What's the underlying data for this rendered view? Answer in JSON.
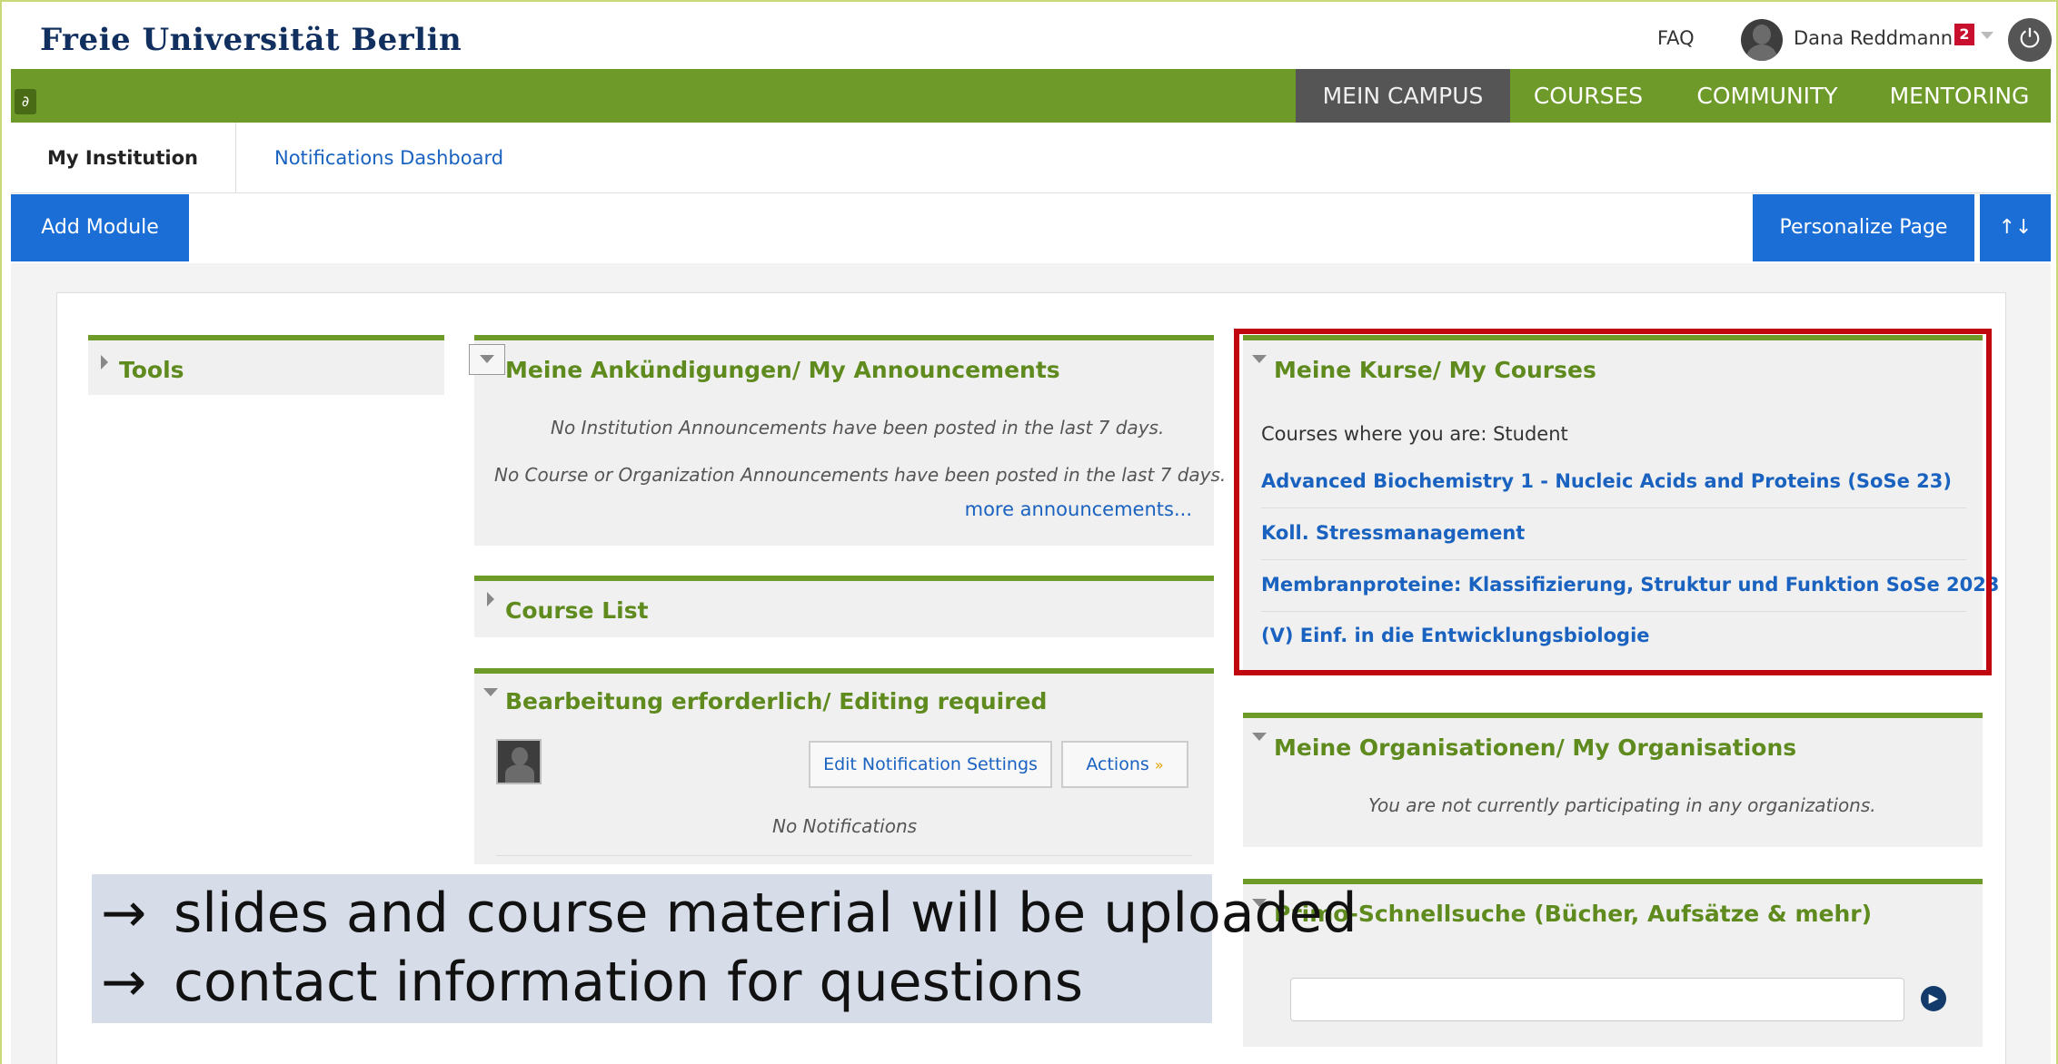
{
  "header": {
    "logo": "Freie Universität Berlin",
    "faq": "FAQ",
    "username": "Dana Reddmann",
    "notification_count": "2"
  },
  "nav": {
    "items": [
      "MEIN CAMPUS",
      "COURSES",
      "COMMUNITY",
      "MENTORING"
    ],
    "active": "MEIN CAMPUS"
  },
  "subtabs": {
    "my_institution": "My Institution",
    "notifications_dashboard": "Notifications Dashboard"
  },
  "actions": {
    "add_module": "Add Module",
    "personalize": "Personalize Page",
    "reorder_icon": "↑↓"
  },
  "modules": {
    "tools": {
      "title": "Tools"
    },
    "announcements": {
      "title": "Meine Ankündigungen/ My Announcements",
      "institution_msg": "No Institution Announcements have been posted in the last 7 days.",
      "course_msg": "No Course or Organization Announcements have been posted in the last 7 days.",
      "more_link": "more announcements..."
    },
    "course_list": {
      "title": "Course List"
    },
    "editing": {
      "title": "Bearbeitung erforderlich/ Editing required",
      "edit_settings": "Edit Notification Settings",
      "actions": "Actions",
      "no_notifications": "No Notifications"
    },
    "courses": {
      "title": "Meine Kurse/ My Courses",
      "role_line": "Courses where you are: Student",
      "items": [
        "Advanced Biochemistry 1 - Nucleic Acids and Proteins (SoSe 23)",
        "Koll. Stressmanagement",
        "Membranproteine: Klassifizierung, Struktur und Funktion SoSe 2023",
        "(V) Einf. in die Entwicklungsbiologie"
      ]
    },
    "organisations": {
      "title": "Meine Organisationen/ My Organisations",
      "message": "You are not currently participating in any organizations."
    },
    "primo": {
      "title": "Primo-Schnellsuche (Bücher, Aufsätze & mehr)",
      "search_value": ""
    }
  },
  "note": {
    "arrow": "→",
    "lines": [
      "slides and course material will be uploaded",
      "contact information for questions"
    ]
  },
  "colors": {
    "brand_green": "#6e9a2a",
    "link_blue": "#1a62c0",
    "button_blue": "#1a6ed6",
    "highlight_red": "#c0070f"
  }
}
